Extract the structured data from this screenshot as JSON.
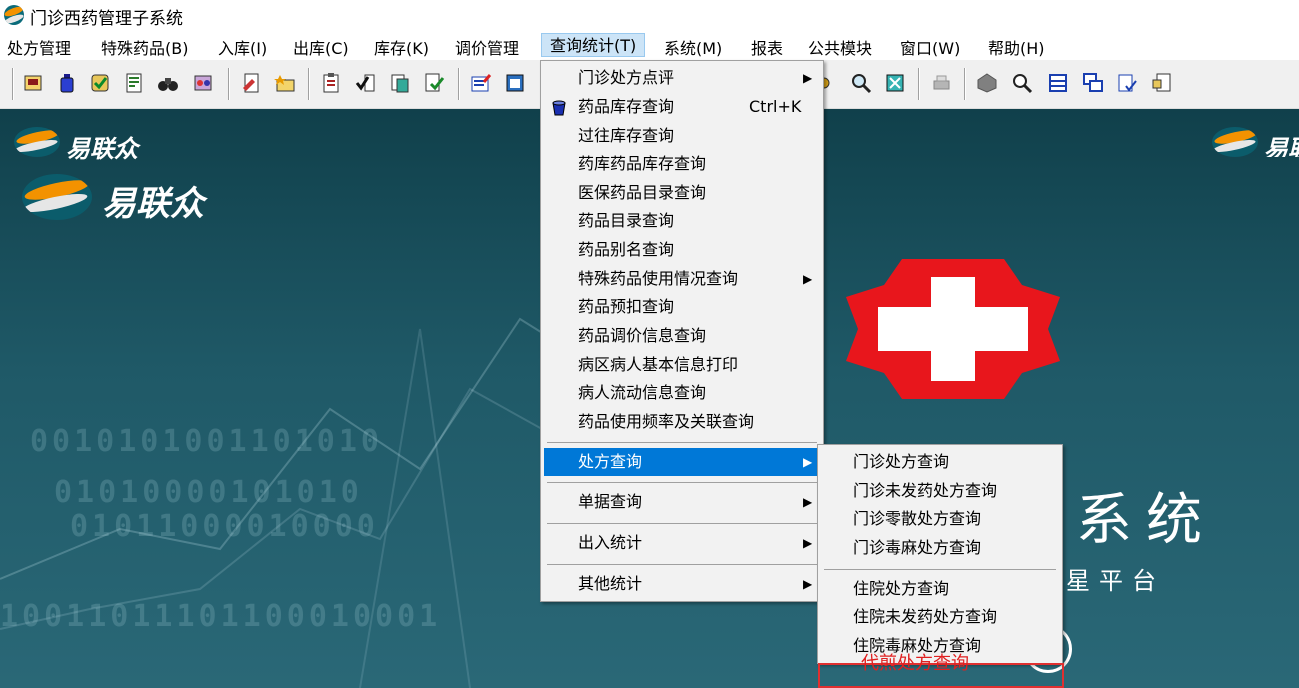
{
  "window": {
    "title": "门诊西药管理子系统"
  },
  "menubar": [
    "处方管理",
    "特殊药品(B)",
    "入库(I)",
    "出库(C)",
    "库存(K)",
    "调价管理",
    "查询统计(T)",
    "系统(M)",
    "报表",
    "公共模块",
    "窗口(W)",
    "帮助(H)"
  ],
  "query_menu": {
    "items": [
      {
        "label": "门诊处方点评",
        "submenu": true
      },
      {
        "label": "药品库存查询",
        "shortcut": "Ctrl+K",
        "icon": "bucket-icon"
      },
      {
        "label": "过往库存查询"
      },
      {
        "label": "药库药品库存查询"
      },
      {
        "label": "医保药品目录查询"
      },
      {
        "label": "药品目录查询"
      },
      {
        "label": "药品别名查询"
      },
      {
        "label": "特殊药品使用情况查询",
        "submenu": true
      },
      {
        "label": "药品预扣查询"
      },
      {
        "label": "药品调价信息查询"
      },
      {
        "label": "病区病人基本信息打印"
      },
      {
        "label": "病人流动信息查询"
      },
      {
        "label": "药品使用频率及关联查询"
      },
      {
        "label": "处方查询",
        "submenu": true,
        "highlighted": true
      },
      {
        "label": "单据查询",
        "submenu": true
      },
      {
        "label": "出入统计",
        "submenu": true
      },
      {
        "label": "其他统计",
        "submenu": true
      }
    ]
  },
  "prescription_submenu": {
    "items": [
      "门诊处方查询",
      "门诊未发药处方查询",
      "门诊零散处方查询",
      "门诊毒麻处方查询",
      "住院处方查询",
      "住院未发药处方查询",
      "住院毒麻处方查询"
    ]
  },
  "annotation": {
    "text": "代煎处方查询",
    "color": "#e02020"
  },
  "background": {
    "brand": "易联众",
    "system_title": "系统",
    "system_subtitle": "星平台",
    "binary_rows": [
      "0010101001101010",
      "01010000101010",
      "01011000010000",
      "10011011101100010001"
    ]
  },
  "colors": {
    "highlight": "#0078d7",
    "menubar_active": "#cce4f7",
    "workspace": "#1f5967",
    "cross_red": "#e8161c"
  },
  "toolbar_icons": [
    "inbox-icon",
    "bottle-icon",
    "approve-icon",
    "report-icon",
    "binoculars-icon",
    "pill-icon",
    "document-edit-icon",
    "folder-star-icon",
    "clipboard-icon",
    "check-list-icon",
    "paste-icon",
    "check-doc-icon",
    "edit-form-icon",
    "window-icon",
    "pharmacy-icon",
    "search-icon",
    "cancel-box-icon",
    "printer-icon",
    "shape-icon",
    "zoom-icon",
    "table-icon",
    "cascade-icon",
    "checklist-icon",
    "paste-special-icon"
  ]
}
